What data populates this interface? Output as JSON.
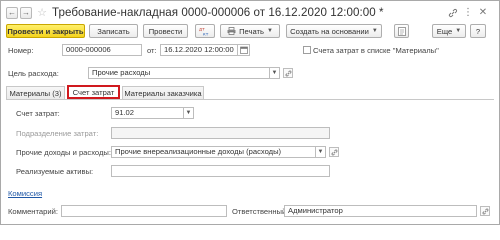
{
  "title": {
    "text": "Требование-накладная 0000-000006 от 16.12.2020 12:00:00 *"
  },
  "toolbar": {
    "post_close": "Провести и закрыть",
    "save": "Записать",
    "post": "Провести",
    "print": "Печать",
    "create_based": "Создать на основании",
    "more": "Еще",
    "help": "?"
  },
  "form": {
    "number_label": "Номер:",
    "number_value": "0000-000006",
    "date_label": "от:",
    "date_value": "16.12.2020 12:00:00",
    "cost_account_check_label": "Счета затрат в списке \"Материалы\"",
    "purpose_label": "Цель расхода:",
    "purpose_value": "Прочие расходы"
  },
  "tabs": [
    {
      "label": "Материалы (3)"
    },
    {
      "label": "Счет затрат"
    },
    {
      "label": "Материалы заказчика"
    }
  ],
  "cost_tab": {
    "account_label": "Счет затрат:",
    "account_value": "91.02",
    "department_label": "Подразделение затрат:",
    "other_income_label": "Прочие доходы и расходы:",
    "other_income_value": "Прочие внереализационные доходы (расходы)",
    "assets_label": "Реализуемые активы:"
  },
  "footer": {
    "commission_link": "Комиссия",
    "comment_label": "Комментарий:",
    "responsible_label": "Ответственный:",
    "responsible_value": "Администратор"
  },
  "colors": {
    "primary_button": "#f4d31e",
    "active_tab_border": "#d0191e",
    "link": "#1f57a6"
  },
  "icons": [
    "back-arrow-icon",
    "forward-arrow-icon",
    "star-icon",
    "link-icon",
    "more-icon",
    "close-icon",
    "dt-kt-icon",
    "printer-icon",
    "help-icon",
    "calendar-icon",
    "dropdown-icon"
  ]
}
